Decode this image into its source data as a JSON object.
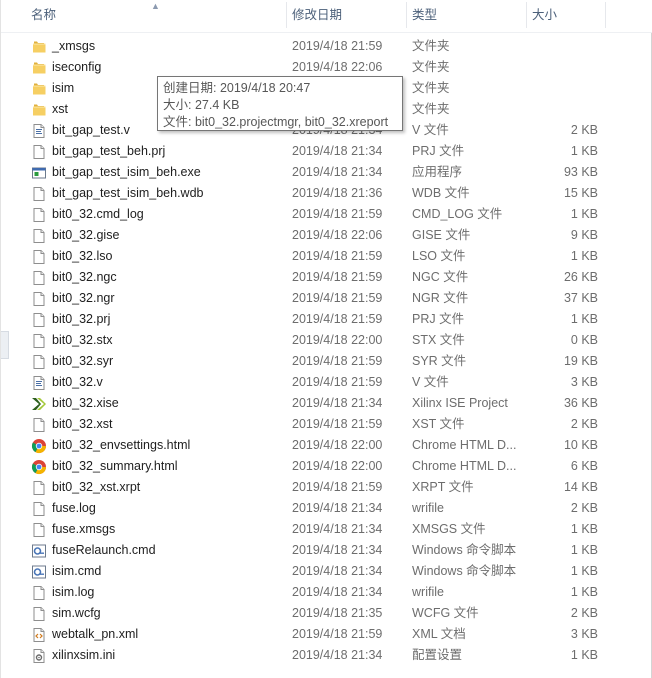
{
  "columns": {
    "name": "名称",
    "modified": "修改日期",
    "type": "类型",
    "size": "大小"
  },
  "files": [
    {
      "name": "_xmsgs",
      "date": "2019/4/18 21:59",
      "type": "文件夹",
      "size": "",
      "icon": "folder-icon"
    },
    {
      "name": "iseconfig",
      "date": "2019/4/18 22:06",
      "type": "文件夹",
      "size": "",
      "icon": "folder-icon"
    },
    {
      "name": "isim",
      "date": "2019/4/18 21:34",
      "type": "文件夹",
      "size": "",
      "icon": "folder-icon"
    },
    {
      "name": "xst",
      "date": "2019/4/18 21:59",
      "type": "文件夹",
      "size": "",
      "icon": "folder-icon"
    },
    {
      "name": "bit_gap_test.v",
      "date": "2019/4/18 21:34",
      "type": "V 文件",
      "size": "2 KB",
      "icon": "source-file-icon"
    },
    {
      "name": "bit_gap_test_beh.prj",
      "date": "2019/4/18 21:34",
      "type": "PRJ 文件",
      "size": "1 KB",
      "icon": "blank-file-icon"
    },
    {
      "name": "bit_gap_test_isim_beh.exe",
      "date": "2019/4/18 21:34",
      "type": "应用程序",
      "size": "93 KB",
      "icon": "exe-icon"
    },
    {
      "name": "bit_gap_test_isim_beh.wdb",
      "date": "2019/4/18 21:36",
      "type": "WDB 文件",
      "size": "15 KB",
      "icon": "blank-file-icon"
    },
    {
      "name": "bit0_32.cmd_log",
      "date": "2019/4/18 21:59",
      "type": "CMD_LOG 文件",
      "size": "1 KB",
      "icon": "blank-file-icon"
    },
    {
      "name": "bit0_32.gise",
      "date": "2019/4/18 22:06",
      "type": "GISE 文件",
      "size": "9 KB",
      "icon": "blank-file-icon"
    },
    {
      "name": "bit0_32.lso",
      "date": "2019/4/18 21:59",
      "type": "LSO 文件",
      "size": "1 KB",
      "icon": "blank-file-icon"
    },
    {
      "name": "bit0_32.ngc",
      "date": "2019/4/18 21:59",
      "type": "NGC 文件",
      "size": "26 KB",
      "icon": "blank-file-icon"
    },
    {
      "name": "bit0_32.ngr",
      "date": "2019/4/18 21:59",
      "type": "NGR 文件",
      "size": "37 KB",
      "icon": "blank-file-icon"
    },
    {
      "name": "bit0_32.prj",
      "date": "2019/4/18 21:59",
      "type": "PRJ 文件",
      "size": "1 KB",
      "icon": "blank-file-icon"
    },
    {
      "name": "bit0_32.stx",
      "date": "2019/4/18 22:00",
      "type": "STX 文件",
      "size": "0 KB",
      "icon": "blank-file-icon"
    },
    {
      "name": "bit0_32.syr",
      "date": "2019/4/18 21:59",
      "type": "SYR 文件",
      "size": "19 KB",
      "icon": "blank-file-icon"
    },
    {
      "name": "bit0_32.v",
      "date": "2019/4/18 21:59",
      "type": "V 文件",
      "size": "3 KB",
      "icon": "source-file-icon"
    },
    {
      "name": "bit0_32.xise",
      "date": "2019/4/18 21:34",
      "type": "Xilinx ISE Project",
      "size": "36 KB",
      "icon": "xilinx-ise-icon"
    },
    {
      "name": "bit0_32.xst",
      "date": "2019/4/18 21:59",
      "type": "XST 文件",
      "size": "2 KB",
      "icon": "blank-file-icon"
    },
    {
      "name": "bit0_32_envsettings.html",
      "date": "2019/4/18 22:00",
      "type": "Chrome HTML D...",
      "size": "10 KB",
      "icon": "chrome-icon"
    },
    {
      "name": "bit0_32_summary.html",
      "date": "2019/4/18 22:00",
      "type": "Chrome HTML D...",
      "size": "6 KB",
      "icon": "chrome-icon"
    },
    {
      "name": "bit0_32_xst.xrpt",
      "date": "2019/4/18 21:59",
      "type": "XRPT 文件",
      "size": "14 KB",
      "icon": "blank-file-icon"
    },
    {
      "name": "fuse.log",
      "date": "2019/4/18 21:34",
      "type": "wrifile",
      "size": "2 KB",
      "icon": "blank-file-icon"
    },
    {
      "name": "fuse.xmsgs",
      "date": "2019/4/18 21:34",
      "type": "XMSGS 文件",
      "size": "1 KB",
      "icon": "blank-file-icon"
    },
    {
      "name": "fuseRelaunch.cmd",
      "date": "2019/4/18 21:34",
      "type": "Windows 命令脚本",
      "size": "1 KB",
      "icon": "cmd-script-icon"
    },
    {
      "name": "isim.cmd",
      "date": "2019/4/18 21:34",
      "type": "Windows 命令脚本",
      "size": "1 KB",
      "icon": "cmd-script-icon"
    },
    {
      "name": "isim.log",
      "date": "2019/4/18 21:34",
      "type": "wrifile",
      "size": "1 KB",
      "icon": "blank-file-icon"
    },
    {
      "name": "sim.wcfg",
      "date": "2019/4/18 21:35",
      "type": "WCFG 文件",
      "size": "2 KB",
      "icon": "blank-file-icon"
    },
    {
      "name": "webtalk_pn.xml",
      "date": "2019/4/18 21:59",
      "type": "XML 文档",
      "size": "3 KB",
      "icon": "xml-icon"
    },
    {
      "name": "xilinxsim.ini",
      "date": "2019/4/18 21:34",
      "type": "配置设置",
      "size": "1 KB",
      "icon": "ini-settings-icon"
    }
  ],
  "tooltip": {
    "created": "创建日期: 2019/4/18 20:47",
    "size": "大小: 27.4 KB",
    "files": "文件: bit0_32.projectmgr, bit0_32.xreport"
  }
}
